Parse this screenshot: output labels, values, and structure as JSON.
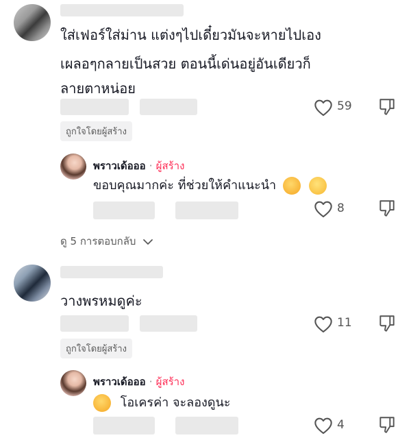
{
  "comments": [
    {
      "text_line1": "ใส่เฟอร์ใส่ม่าน แต่งๆไปเดี๋ยวมันจะหายไปเอง",
      "text_line2": "เผลอๆกลายเป็นสวย ตอนนี้เด่นอยู่อันเดียวก็",
      "text_line3": "ลายตาหน่อย",
      "likes": "59",
      "liked_by_creator": "ถูกใจโดยผู้สร้าง",
      "reply": {
        "author": "พราวเด้อออ",
        "separator": "·",
        "creator_tag": "ผู้สร้าง",
        "text": "ขอบคุณมากค่ะ ที่ช่วยให้คำแนะนำ",
        "likes": "8"
      },
      "view_replies": "ดู 5 การตอบกลับ"
    },
    {
      "text_line1": "วางพรหมดูค่ะ",
      "likes": "11",
      "liked_by_creator": "ถูกใจโดยผู้สร้าง",
      "reply": {
        "author": "พราวเด้อออ",
        "separator": "·",
        "creator_tag": "ผู้สร้าง",
        "text": "โอเครค่า จะลองดูนะ",
        "likes": "4"
      }
    }
  ],
  "icons": {
    "heart": "heart-outline-icon",
    "dislike": "thumbs-down-icon",
    "chevron": "chevron-down-icon"
  },
  "colors": {
    "creator_tag": "#fe2c55",
    "badge_bg": "#f1f1f2",
    "text": "#161823"
  }
}
